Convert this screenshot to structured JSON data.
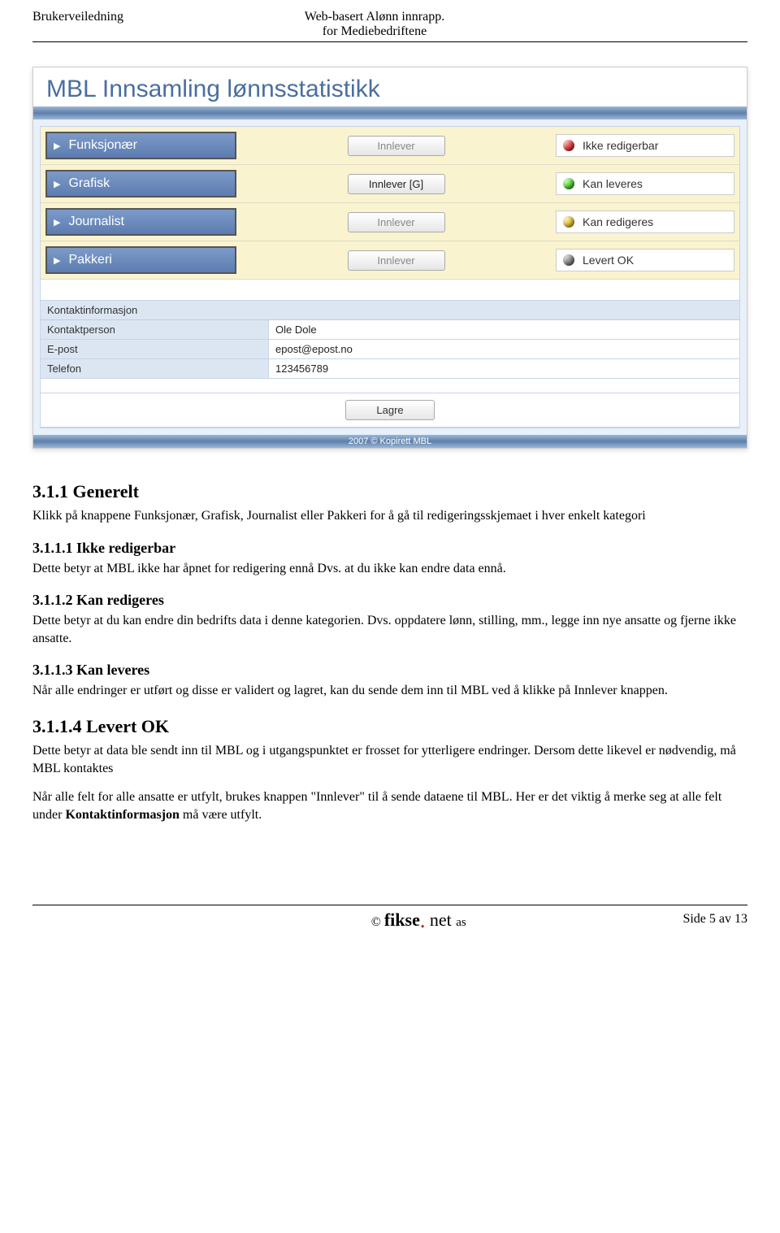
{
  "header": {
    "left": "Brukerveiledning",
    "center_l1": "Web-basert Alønn innrapp.",
    "center_l2": "for Mediebedriftene"
  },
  "screenshot": {
    "app_title": "MBL Innsamling lønnsstatistikk",
    "categories": [
      {
        "name": "Funksjonær",
        "innlever": "Innlever",
        "enabled": false,
        "status": "Ikke redigerbar",
        "dot": "red"
      },
      {
        "name": "Grafisk",
        "innlever": "Innlever [G]",
        "enabled": true,
        "status": "Kan leveres",
        "dot": "green"
      },
      {
        "name": "Journalist",
        "innlever": "Innlever",
        "enabled": false,
        "status": "Kan redigeres",
        "dot": "yellow"
      },
      {
        "name": "Pakkeri",
        "innlever": "Innlever",
        "enabled": false,
        "status": "Levert OK",
        "dot": "gray"
      }
    ],
    "contact": {
      "section": "Kontaktinformasjon",
      "fields": [
        {
          "label": "Kontaktperson",
          "value": "Ole Dole"
        },
        {
          "label": "E-post",
          "value": "epost@epost.no"
        },
        {
          "label": "Telefon",
          "value": "123456789"
        }
      ]
    },
    "save_label": "Lagre",
    "footer": "2007 © Kopirett MBL"
  },
  "sections": {
    "s311_num": "3.1.1   Generelt",
    "s311_text": "Klikk på knappene Funksjonær, Grafisk, Journalist eller Pakkeri for å gå til redigeringsskjemaet i hver enkelt kategori",
    "s3111_num": "3.1.1.1 Ikke redigerbar",
    "s3111_text": "Dette betyr at MBL ikke har åpnet for redigering ennå Dvs. at du ikke kan endre data ennå.",
    "s3112_num": "3.1.1.2 Kan redigeres",
    "s3112_text": "Dette betyr at du kan endre din bedrifts data i denne kategorien. Dvs. oppdatere lønn, stilling, mm., legge inn nye ansatte og fjerne ikke ansatte.",
    "s3113_num": "3.1.1.3  Kan leveres",
    "s3113_text": "Når alle endringer er utført og disse er validert og lagret, kan du sende dem inn til MBL ved å klikke på Innlever knappen.",
    "s3114_num": "3.1.1.4 Levert OK",
    "s3114_text1": "Dette betyr at data ble sendt inn til MBL og i utgangspunktet er frosset for ytterligere endringer. Dersom dette likevel er nødvendig, må MBL kontaktes",
    "s3114_text2a": "Når alle felt for alle ansatte er utfylt, brukes knappen \"Innlever\" til å sende dataene til MBL. Her er det viktig å merke seg at alle felt under ",
    "s3114_text2b": "Kontaktinformasjon",
    "s3114_text2c": " må være utfylt."
  },
  "footer": {
    "brand_c": "© ",
    "brand1": "fikse",
    "brand2": " net ",
    "brand3": "as",
    "page": "Side 5 av  13"
  }
}
